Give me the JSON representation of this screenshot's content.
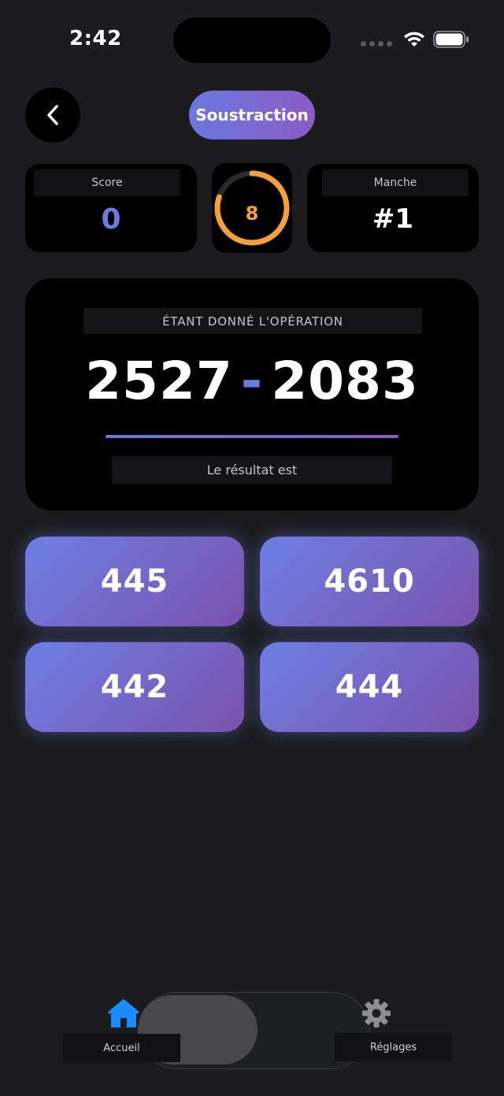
{
  "status_bar": {
    "time": "2:42"
  },
  "header": {
    "title": "Soustraction"
  },
  "stats": {
    "score_label": "Score",
    "score_value": "0",
    "timer_value": "8",
    "timer_progress": 0.8,
    "round_label": "Manche",
    "round_value": "#1"
  },
  "question": {
    "prompt": "ÉTANT DONNÉ L'OPÉRATION",
    "operand_a": "2527",
    "operator": "-",
    "operand_b": "2083",
    "result_label": "Le résultat est"
  },
  "answers": [
    "445",
    "4610",
    "442",
    "444"
  ],
  "tab_bar": {
    "home_label": "Accueil",
    "settings_label": "Réglages"
  },
  "colors": {
    "background": "#1c1c1e",
    "accent": "#6d7ae0",
    "accent_end": "#8a5cc4",
    "timer": "#f5a03a",
    "tab_active": "#1a8cff"
  }
}
